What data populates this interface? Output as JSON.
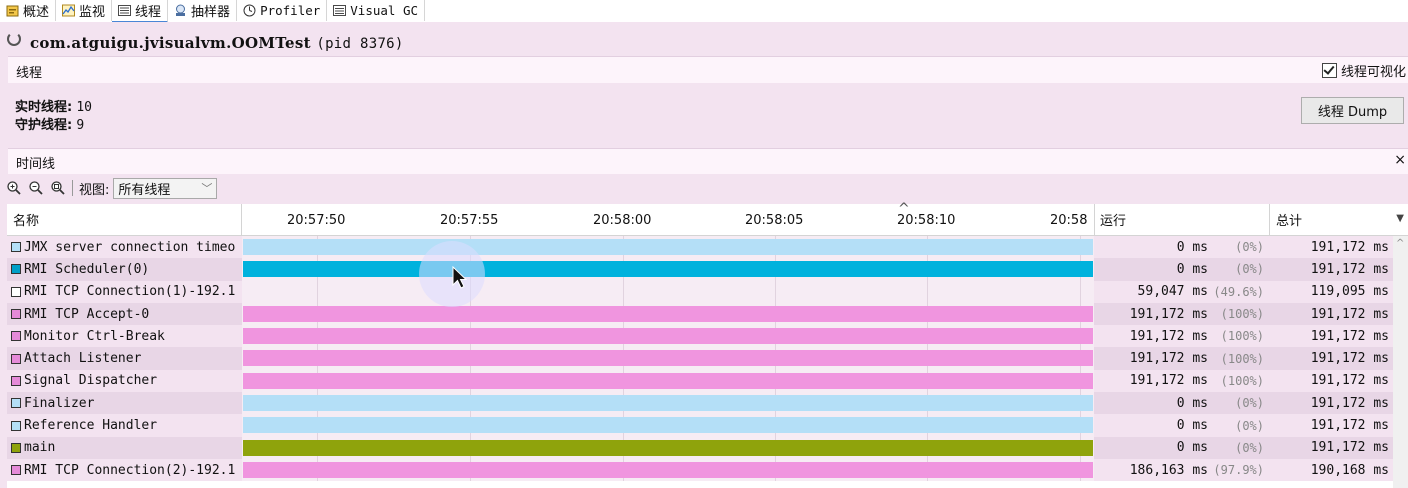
{
  "tabs": [
    {
      "label": "概述",
      "icon": "overview-icon"
    },
    {
      "label": "监视",
      "icon": "monitor-icon"
    },
    {
      "label": "线程",
      "icon": "threads-icon",
      "active": true
    },
    {
      "label": "抽样器",
      "icon": "sampler-icon"
    },
    {
      "label": "Profiler",
      "icon": "profiler-icon"
    },
    {
      "label": "Visual GC",
      "icon": "visual-gc-icon"
    }
  ],
  "header": {
    "app": "com.atguigu.jvisualvm.OOMTest",
    "pid": "(pid 8376)"
  },
  "threads_section": {
    "title": "线程",
    "visualize_label": "线程可视化",
    "visualize_checked": true
  },
  "stats": {
    "live_label": "实时线程:",
    "live_value": "10",
    "daemon_label": "守护线程:",
    "daemon_value": "9"
  },
  "dump_button": "线程 Dump",
  "timeline_section": {
    "title": "时间线",
    "close": "×"
  },
  "toolbar": {
    "view_label": "视图:",
    "view_value": "所有线程"
  },
  "table": {
    "col_name": "名称",
    "col_run": "运行",
    "col_total": "总计",
    "ticks": [
      "20:57:50",
      "20:57:55",
      "20:58:00",
      "20:58:05",
      "20:58:10",
      "20:58"
    ],
    "rows": [
      {
        "name": "JMX server connection timeo",
        "state": "waiting",
        "run": "0 ms",
        "pct": "(0%)",
        "total": "191,172 ms"
      },
      {
        "name": "RMI Scheduler(0)",
        "state": "timed",
        "run": "0 ms",
        "pct": "(0%)",
        "total": "191,172 ms"
      },
      {
        "name": "RMI TCP Connection(1)-192.1",
        "state": "none",
        "run": "59,047 ms",
        "pct": "(49.6%)",
        "total": "119,095 ms"
      },
      {
        "name": "RMI TCP Accept-0",
        "state": "running",
        "run": "191,172 ms",
        "pct": "(100%)",
        "total": "191,172 ms"
      },
      {
        "name": "Monitor Ctrl-Break",
        "state": "running",
        "run": "191,172 ms",
        "pct": "(100%)",
        "total": "191,172 ms"
      },
      {
        "name": "Attach Listener",
        "state": "running",
        "run": "191,172 ms",
        "pct": "(100%)",
        "total": "191,172 ms"
      },
      {
        "name": "Signal Dispatcher",
        "state": "running",
        "run": "191,172 ms",
        "pct": "(100%)",
        "total": "191,172 ms"
      },
      {
        "name": "Finalizer",
        "state": "waiting",
        "run": "0 ms",
        "pct": "(0%)",
        "total": "191,172 ms"
      },
      {
        "name": "Reference Handler",
        "state": "waiting",
        "run": "0 ms",
        "pct": "(0%)",
        "total": "191,172 ms"
      },
      {
        "name": "main",
        "state": "sleeping",
        "run": "0 ms",
        "pct": "(0%)",
        "total": "191,172 ms"
      },
      {
        "name": "RMI TCP Connection(2)-192.1",
        "state": "running",
        "run": "186,163 ms",
        "pct": "(97.9%)",
        "total": "190,168 ms"
      }
    ]
  },
  "state_colors": {
    "running": "#f095df",
    "waiting": "#b4dff7",
    "timed": "#00b2dd",
    "sleeping": "#8fa30c",
    "none": "#f6ecf4"
  },
  "swatch_colors": {
    "running": "#e58ad8",
    "waiting": "#b4dff7",
    "timed": "#00a0c8",
    "sleeping": "#8fa30c",
    "none": "#ffffff"
  }
}
